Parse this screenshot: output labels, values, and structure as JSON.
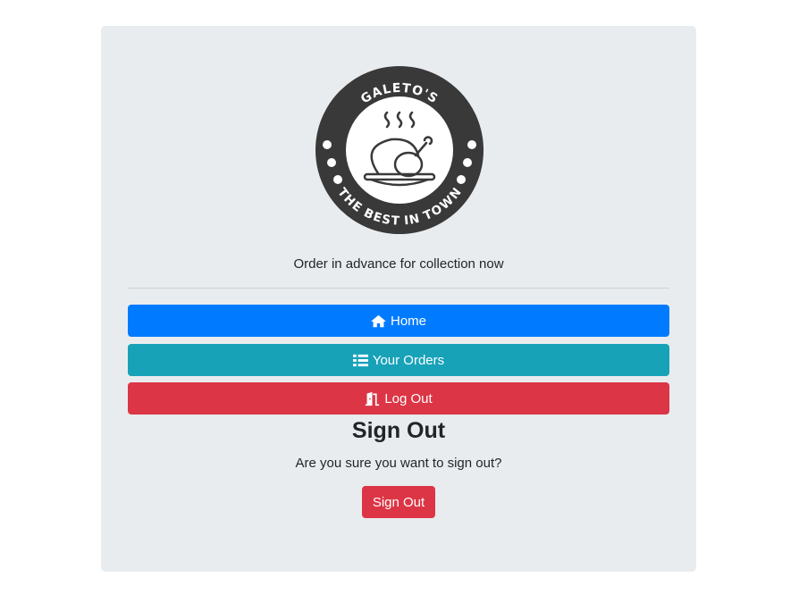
{
  "logo": {
    "top_text": "GALETO'S",
    "bottom_text": "THE BEST IN TOWN"
  },
  "tagline": "Order in advance for collection now",
  "nav": {
    "home": "Home",
    "orders": "Your Orders",
    "logout": "Log Out"
  },
  "signout": {
    "title": "Sign Out",
    "question": "Are you sure you want to sign out?",
    "button": "Sign Out"
  },
  "colors": {
    "primary": "#007bff",
    "info": "#17a2b8",
    "danger": "#dc3545",
    "card": "#e9ecef"
  }
}
